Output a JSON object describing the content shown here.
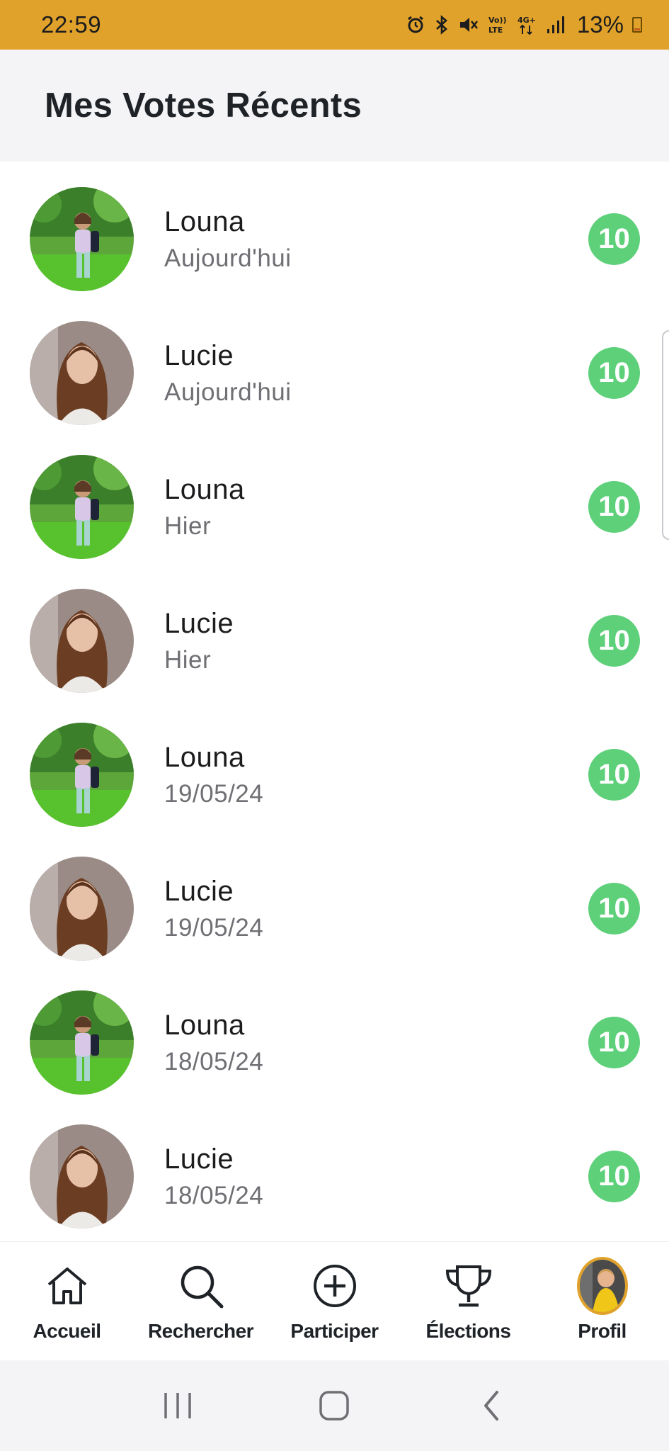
{
  "status_bar": {
    "time": "22:59",
    "battery": "13%",
    "network": "4G+",
    "volte": "Vo) LTE"
  },
  "header": {
    "title": "Mes Votes Récents"
  },
  "colors": {
    "accent": "#E0A22A",
    "score_badge": "#5ed07a"
  },
  "votes": [
    {
      "name": "Louna",
      "date": "Aujourd'hui",
      "score": "10",
      "avatar": "girl-in-park"
    },
    {
      "name": "Lucie",
      "date": "Aujourd'hui",
      "score": "10",
      "avatar": "girl-portrait"
    },
    {
      "name": "Louna",
      "date": "Hier",
      "score": "10",
      "avatar": "girl-in-park"
    },
    {
      "name": "Lucie",
      "date": "Hier",
      "score": "10",
      "avatar": "girl-portrait"
    },
    {
      "name": "Louna",
      "date": "19/05/24",
      "score": "10",
      "avatar": "girl-in-park"
    },
    {
      "name": "Lucie",
      "date": "19/05/24",
      "score": "10",
      "avatar": "girl-portrait"
    },
    {
      "name": "Louna",
      "date": "18/05/24",
      "score": "10",
      "avatar": "girl-in-park"
    },
    {
      "name": "Lucie",
      "date": "18/05/24",
      "score": "10",
      "avatar": "girl-portrait"
    }
  ],
  "bottom_nav": {
    "items": [
      {
        "label": "Accueil",
        "icon": "home-icon"
      },
      {
        "label": "Rechercher",
        "icon": "search-icon"
      },
      {
        "label": "Participer",
        "icon": "plus-circle-icon"
      },
      {
        "label": "Élections",
        "icon": "trophy-icon"
      },
      {
        "label": "Profil",
        "icon": "profile-avatar"
      }
    ]
  },
  "system_nav": {
    "items": [
      "recent-apps",
      "home",
      "back"
    ]
  }
}
